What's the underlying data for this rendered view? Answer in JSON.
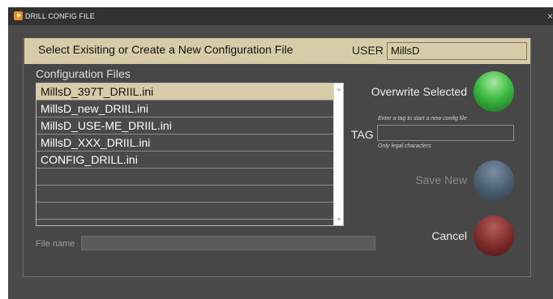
{
  "window": {
    "title": "DRILL CONFIG FILE",
    "close_glyph": "×"
  },
  "header": {
    "title": "Select Exisiting or Create a New Configuration File",
    "user_label": "USER",
    "user_value": "MillsD"
  },
  "file_list": {
    "title": "Configuration Files",
    "selected_index": 0,
    "items": [
      "MillsD_397T_DRIIL.ini",
      "MillsD_new_DRIIL.ini",
      "MillsD_USE-ME_DRIIL.ini",
      "MillsD_XXX_DRIIL.ini",
      "CONFIG_DRILL.ini",
      "",
      "",
      "",
      ""
    ]
  },
  "file_name": {
    "label": "File name",
    "value": ""
  },
  "buttons": {
    "overwrite": "Overwrite Selected",
    "save_new": "Save New",
    "cancel": "Cancel"
  },
  "tag": {
    "label": "TAG",
    "hint": "Enter a tag to start a new config file",
    "legal_hint": "Only legal characters",
    "value": ""
  },
  "icons": {
    "app": "play-icon",
    "overwrite_orb": "green-orb-icon",
    "save_new_orb": "blue-orb-icon",
    "cancel_orb": "red-orb-icon"
  },
  "colors": {
    "header_bg": "#d8cca8",
    "window_bg": "#4a4a4a",
    "overwrite_orb": "#3fbc44",
    "save_new_orb": "#4a5e72",
    "cancel_orb": "#7c2a2a"
  }
}
